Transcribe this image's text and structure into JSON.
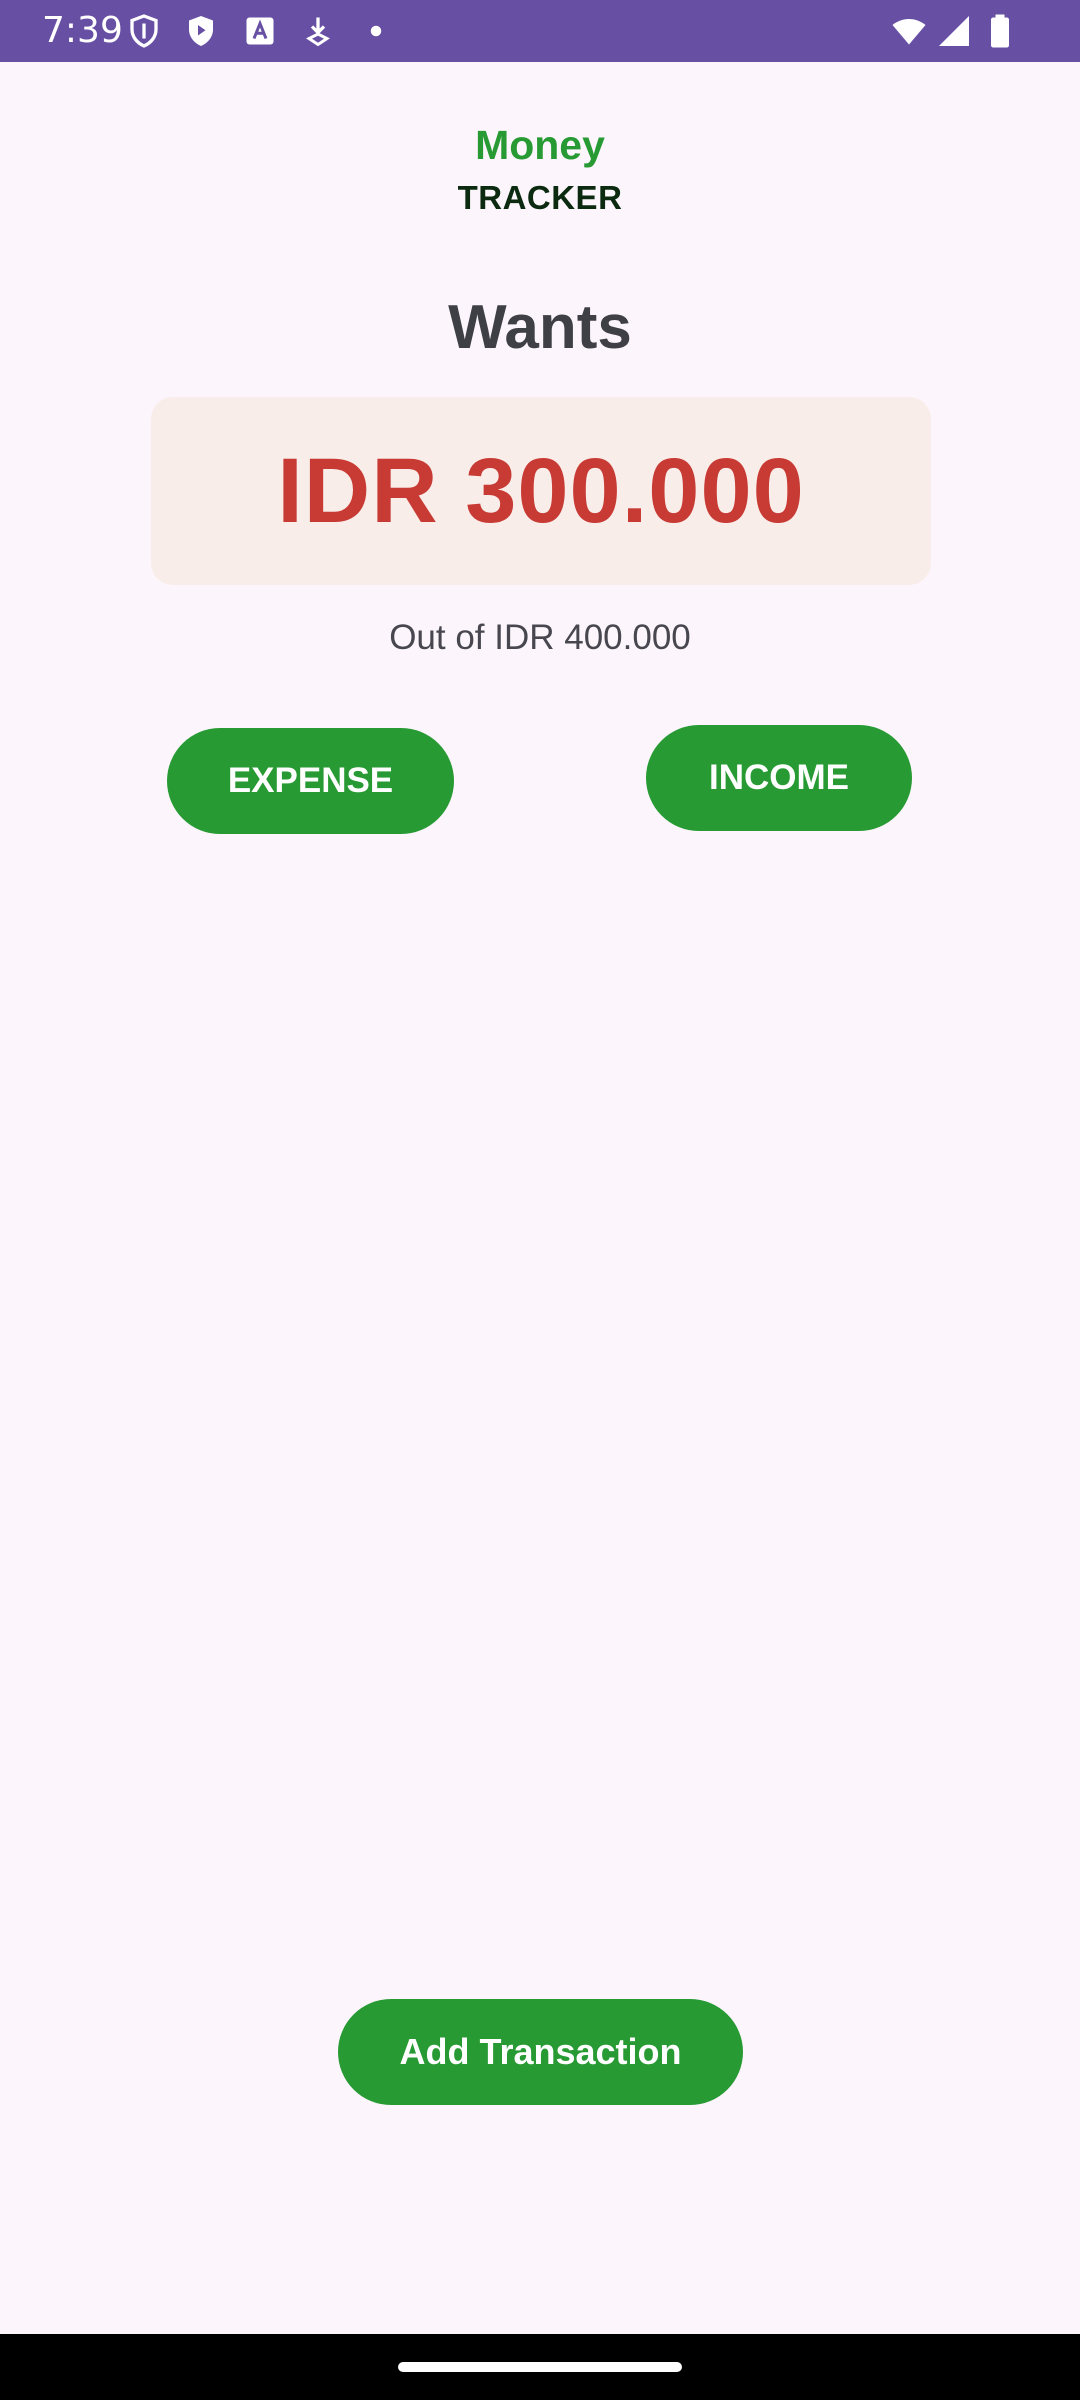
{
  "status_bar": {
    "time": "7:39",
    "background": "#6750a4",
    "left_icons": [
      "shield-icon",
      "play-shield-icon",
      "text-a-icon",
      "download-icon",
      "dot-icon"
    ],
    "right_icons": [
      "wifi-icon",
      "cell-signal-icon",
      "battery-icon"
    ]
  },
  "header": {
    "title": "Money",
    "subtitle": "TRACKER",
    "title_color": "#279a33"
  },
  "budget": {
    "category": "Wants",
    "amount": "IDR 300.000",
    "amount_color": "#c83a34",
    "limit_text": "Out of IDR 400.000"
  },
  "actions": {
    "expense_label": "EXPENSE",
    "income_label": "INCOME",
    "add_transaction_label": "Add Transaction",
    "button_color": "#279a33"
  }
}
